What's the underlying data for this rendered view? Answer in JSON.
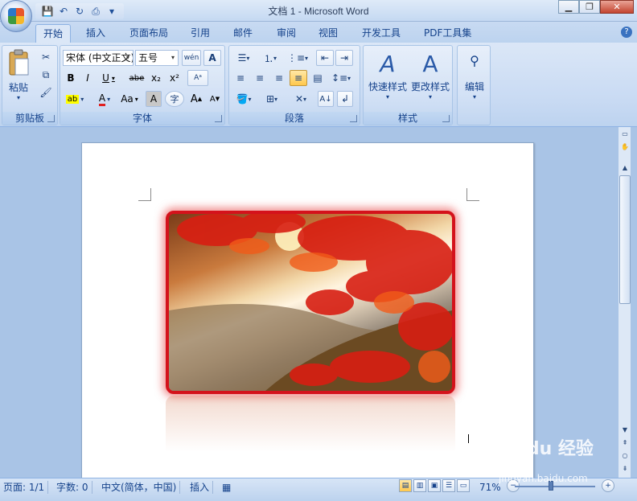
{
  "window": {
    "title": "文档 1 - Microsoft Word",
    "minimize": "▁",
    "maximize": "❐",
    "close": "✕"
  },
  "quick_access": [
    {
      "icon": "save-icon",
      "glyph": "💾"
    },
    {
      "icon": "undo-icon",
      "glyph": "↶"
    },
    {
      "icon": "redo-icon",
      "glyph": "↻"
    },
    {
      "icon": "print-preview-icon",
      "glyph": "⎙"
    },
    {
      "icon": "customize-icon",
      "glyph": "▾"
    }
  ],
  "tabs": [
    "开始",
    "插入",
    "页面布局",
    "引用",
    "邮件",
    "审阅",
    "视图",
    "开发工具",
    "PDF工具集"
  ],
  "active_tab": "开始",
  "help": "?",
  "groups": {
    "clipboard": {
      "label": "剪贴板",
      "paste": "粘贴"
    },
    "font": {
      "label": "字体",
      "font_name": "宋体 (中文正文)",
      "font_size": "五号",
      "bold": "B",
      "italic": "I",
      "underline": "U",
      "strike": "abe",
      "subscript": "x₂",
      "superscript": "x²",
      "change_case": "Aa",
      "grow": "A",
      "shrink": "A",
      "char_shading": "A",
      "enclose": "字",
      "phonetic": "wén",
      "border": "A"
    },
    "paragraph": {
      "label": "段落"
    },
    "styles": {
      "label": "样式",
      "quick_styles": "快速样式",
      "change_styles": "更改样式"
    },
    "editing": {
      "label": "编辑",
      "edit": "编辑"
    }
  },
  "status": {
    "page": "页面: 1/1",
    "words": "字数: 0",
    "language": "中文(简体，中国)",
    "mode": "插入",
    "zoom": "71%"
  },
  "watermark": {
    "brand": "Bai du 经验",
    "url": "jingyan.baidu.com"
  },
  "colors": {
    "accent": "#15428b",
    "frame": "#d4121b",
    "highlight": "#ffff00",
    "font_color": "#e02020"
  }
}
